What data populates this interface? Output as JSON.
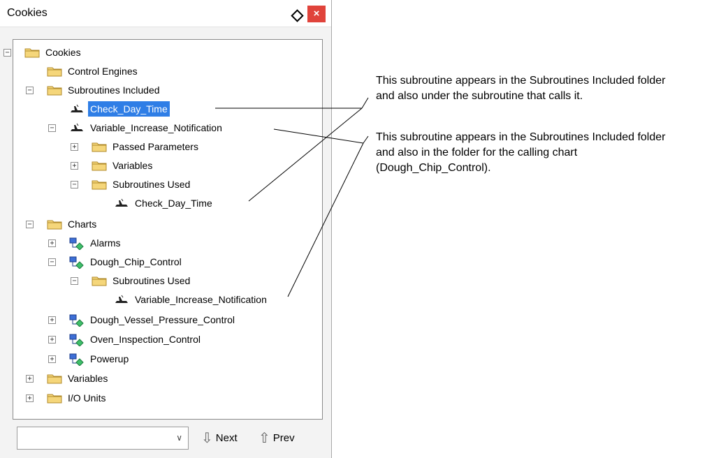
{
  "window": {
    "title": "Cookies",
    "close_label": "×"
  },
  "tree": [
    {
      "id": "n0",
      "label": "Cookies",
      "icon": "folder",
      "toggle": "−"
    },
    {
      "id": "n1",
      "label": "Control Engines",
      "icon": "folder",
      "toggle": ""
    },
    {
      "id": "n2",
      "label": "Subroutines Included",
      "icon": "folder",
      "toggle": "−"
    },
    {
      "id": "n3",
      "label": "Check_Day_Time",
      "icon": "subroutine",
      "toggle": "",
      "selected": true
    },
    {
      "id": "n4",
      "label": "Variable_Increase_Notification",
      "icon": "subroutine",
      "toggle": "−"
    },
    {
      "id": "n5",
      "label": "Passed Parameters",
      "icon": "folder",
      "toggle": "+"
    },
    {
      "id": "n6",
      "label": "Variables",
      "icon": "folder",
      "toggle": "+"
    },
    {
      "id": "n7",
      "label": "Subroutines Used",
      "icon": "folder",
      "toggle": "−"
    },
    {
      "id": "n8",
      "label": "Check_Day_Time",
      "icon": "subroutine",
      "toggle": ""
    },
    {
      "id": "n9",
      "label": "Charts",
      "icon": "folder",
      "toggle": "−"
    },
    {
      "id": "n10",
      "label": "Alarms",
      "icon": "chart",
      "toggle": "+"
    },
    {
      "id": "n11",
      "label": "Dough_Chip_Control",
      "icon": "chart",
      "toggle": "−"
    },
    {
      "id": "n12",
      "label": "Subroutines Used",
      "icon": "folder",
      "toggle": "−"
    },
    {
      "id": "n13",
      "label": "Variable_Increase_Notification",
      "icon": "subroutine",
      "toggle": ""
    },
    {
      "id": "n14",
      "label": "Dough_Vessel_Pressure_Control",
      "icon": "chart",
      "toggle": "+"
    },
    {
      "id": "n15",
      "label": "Oven_Inspection_Control",
      "icon": "chart",
      "toggle": "+"
    },
    {
      "id": "n16",
      "label": "Powerup",
      "icon": "chart",
      "toggle": "+"
    },
    {
      "id": "n17",
      "label": "Variables",
      "icon": "folder",
      "toggle": "+"
    },
    {
      "id": "n18",
      "label": "I/O Units",
      "icon": "folder",
      "toggle": "+"
    }
  ],
  "bottom": {
    "combo_value": "",
    "next_label": "Next",
    "prev_label": "Prev"
  },
  "callouts": {
    "first": {
      "line1": "This subroutine appears in the Subroutines Included folder",
      "line2": "and also under the subroutine that calls it."
    },
    "second": {
      "line1": "This subroutine appears in the Subroutines Included folder",
      "line2": "and also in the folder for the calling chart",
      "line3": "(Dough_Chip_Control)."
    }
  },
  "colors": {
    "selection": "#2f7ee6",
    "close": "#e0433b",
    "folder": "#f5d67a",
    "chart_blue": "#3d6fd6",
    "chart_green": "#3fbf6a"
  }
}
